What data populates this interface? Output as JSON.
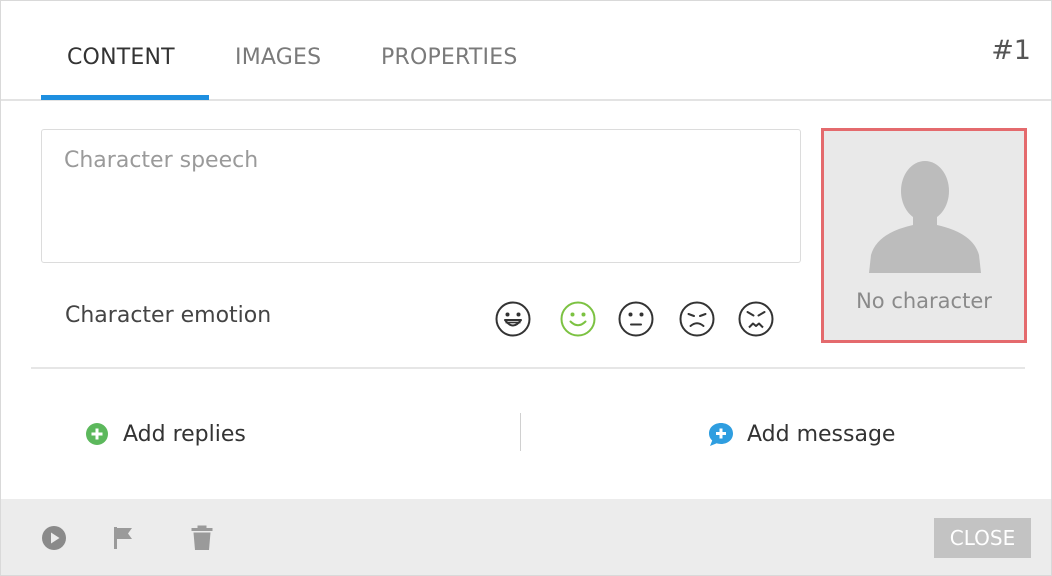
{
  "tabs": [
    {
      "label": "CONTENT",
      "active": true
    },
    {
      "label": "IMAGES",
      "active": false
    },
    {
      "label": "PROPERTIES",
      "active": false
    }
  ],
  "item_number": "#1",
  "speech": {
    "placeholder": "Character speech",
    "value": ""
  },
  "emotion": {
    "label": "Character emotion",
    "options": [
      "very-happy-face-icon",
      "happy-face-icon",
      "neutral-face-icon",
      "sad-face-icon",
      "angry-face-icon"
    ],
    "selected": "happy-face-icon"
  },
  "character": {
    "empty_label": "No character"
  },
  "actions": {
    "add_replies": "Add replies",
    "add_message": "Add message"
  },
  "footer": {
    "close_label": "CLOSE",
    "icons": [
      "play-icon",
      "flag-icon",
      "trash-icon"
    ]
  },
  "colors": {
    "accent": "#1e8fe0",
    "selected_emotion": "#7cc242",
    "character_border": "#e46a6d",
    "add_replies_icon": "#5cb85c",
    "add_message_icon": "#2f9ee0",
    "footer_bg": "#ececec",
    "close_button_bg": "#c3c3c3"
  }
}
